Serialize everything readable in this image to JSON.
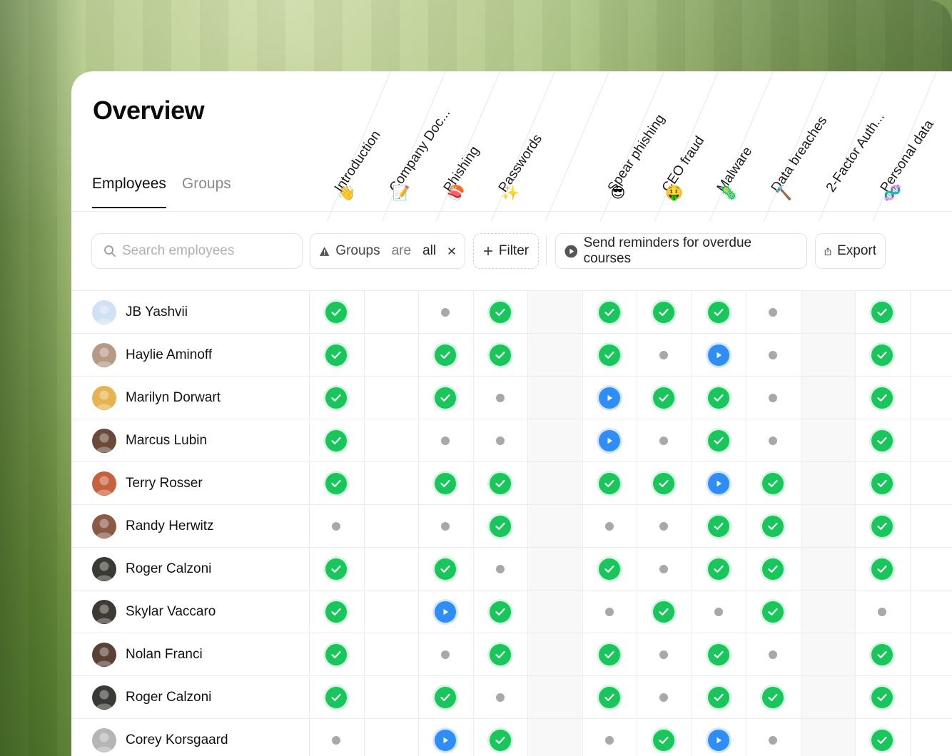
{
  "page": {
    "title": "Overview"
  },
  "tabs": [
    {
      "label": "Employees",
      "active": true
    },
    {
      "label": "Groups",
      "active": false
    }
  ],
  "columns": [
    {
      "label": "Introduction",
      "emoji": "👋"
    },
    {
      "label": "Company Doc...",
      "emoji": "📝"
    },
    {
      "label": "Phishing",
      "emoji": "🍣"
    },
    {
      "label": "Passwords",
      "emoji": "✨"
    },
    {
      "label": "",
      "emoji": ""
    },
    {
      "label": "Spear phishing",
      "emoji": "😎"
    },
    {
      "label": "CEO fraud",
      "emoji": "🤑"
    },
    {
      "label": "Malware",
      "emoji": "🦠"
    },
    {
      "label": "Data breaches",
      "emoji": "🔨"
    },
    {
      "label": "2-Factor Auth...",
      "emoji": ""
    },
    {
      "label": "Personal data",
      "emoji": "🧬"
    }
  ],
  "toolbar": {
    "search_placeholder": "Search employees",
    "filter_chip": {
      "field": "Groups",
      "op": "are",
      "value": "all"
    },
    "filter_label": "Filter",
    "reminder_label": "Send reminders for overdue courses",
    "export_label": "Export"
  },
  "employees": [
    {
      "name": "JB Yashvii",
      "avatar_color": "#cfe1f4",
      "status": [
        "done",
        "",
        "todo",
        "done",
        "",
        "done",
        "done",
        "done",
        "todo",
        "",
        "done"
      ]
    },
    {
      "name": "Haylie Aminoff",
      "avatar_color": "#b79a86",
      "status": [
        "done",
        "",
        "done",
        "done",
        "",
        "done",
        "todo",
        "play",
        "todo",
        "",
        "done"
      ]
    },
    {
      "name": "Marilyn Dorwart",
      "avatar_color": "#e6b352",
      "status": [
        "done",
        "",
        "done",
        "todo",
        "",
        "play",
        "done",
        "done",
        "todo",
        "",
        "done"
      ]
    },
    {
      "name": "Marcus Lubin",
      "avatar_color": "#6a4a3a",
      "status": [
        "done",
        "",
        "todo",
        "todo",
        "",
        "play",
        "todo",
        "done",
        "todo",
        "",
        "done"
      ]
    },
    {
      "name": "Terry Rosser",
      "avatar_color": "#c7603d",
      "status": [
        "done",
        "",
        "done",
        "done",
        "",
        "done",
        "done",
        "play",
        "done",
        "",
        "done"
      ]
    },
    {
      "name": "Randy Herwitz",
      "avatar_color": "#8a5a45",
      "status": [
        "todo",
        "",
        "todo",
        "done",
        "",
        "todo",
        "todo",
        "done",
        "done",
        "",
        "done"
      ]
    },
    {
      "name": "Roger Calzoni",
      "avatar_color": "#3a3a35",
      "status": [
        "done",
        "",
        "done",
        "todo",
        "",
        "done",
        "todo",
        "done",
        "done",
        "",
        "done"
      ]
    },
    {
      "name": "Skylar Vaccaro",
      "avatar_color": "#3d3a34",
      "status": [
        "done",
        "",
        "play",
        "done",
        "",
        "todo",
        "done",
        "todo",
        "done",
        "",
        "todo"
      ]
    },
    {
      "name": "Nolan Franci",
      "avatar_color": "#5b4035",
      "status": [
        "done",
        "",
        "todo",
        "done",
        "",
        "done",
        "todo",
        "done",
        "todo",
        "",
        "done"
      ]
    },
    {
      "name": "Roger Calzoni",
      "avatar_color": "#3a3a35",
      "status": [
        "done",
        "",
        "done",
        "todo",
        "",
        "done",
        "todo",
        "done",
        "done",
        "",
        "done"
      ]
    },
    {
      "name": "Corey Korsgaard",
      "avatar_color": "#b5b5b5",
      "status": [
        "todo",
        "",
        "play",
        "done",
        "",
        "todo",
        "done",
        "play",
        "todo",
        "",
        "done"
      ]
    }
  ],
  "colors": {
    "done": "#18c65b",
    "in_progress": "#2f8ef5",
    "not_started": "#a8a8a8"
  }
}
